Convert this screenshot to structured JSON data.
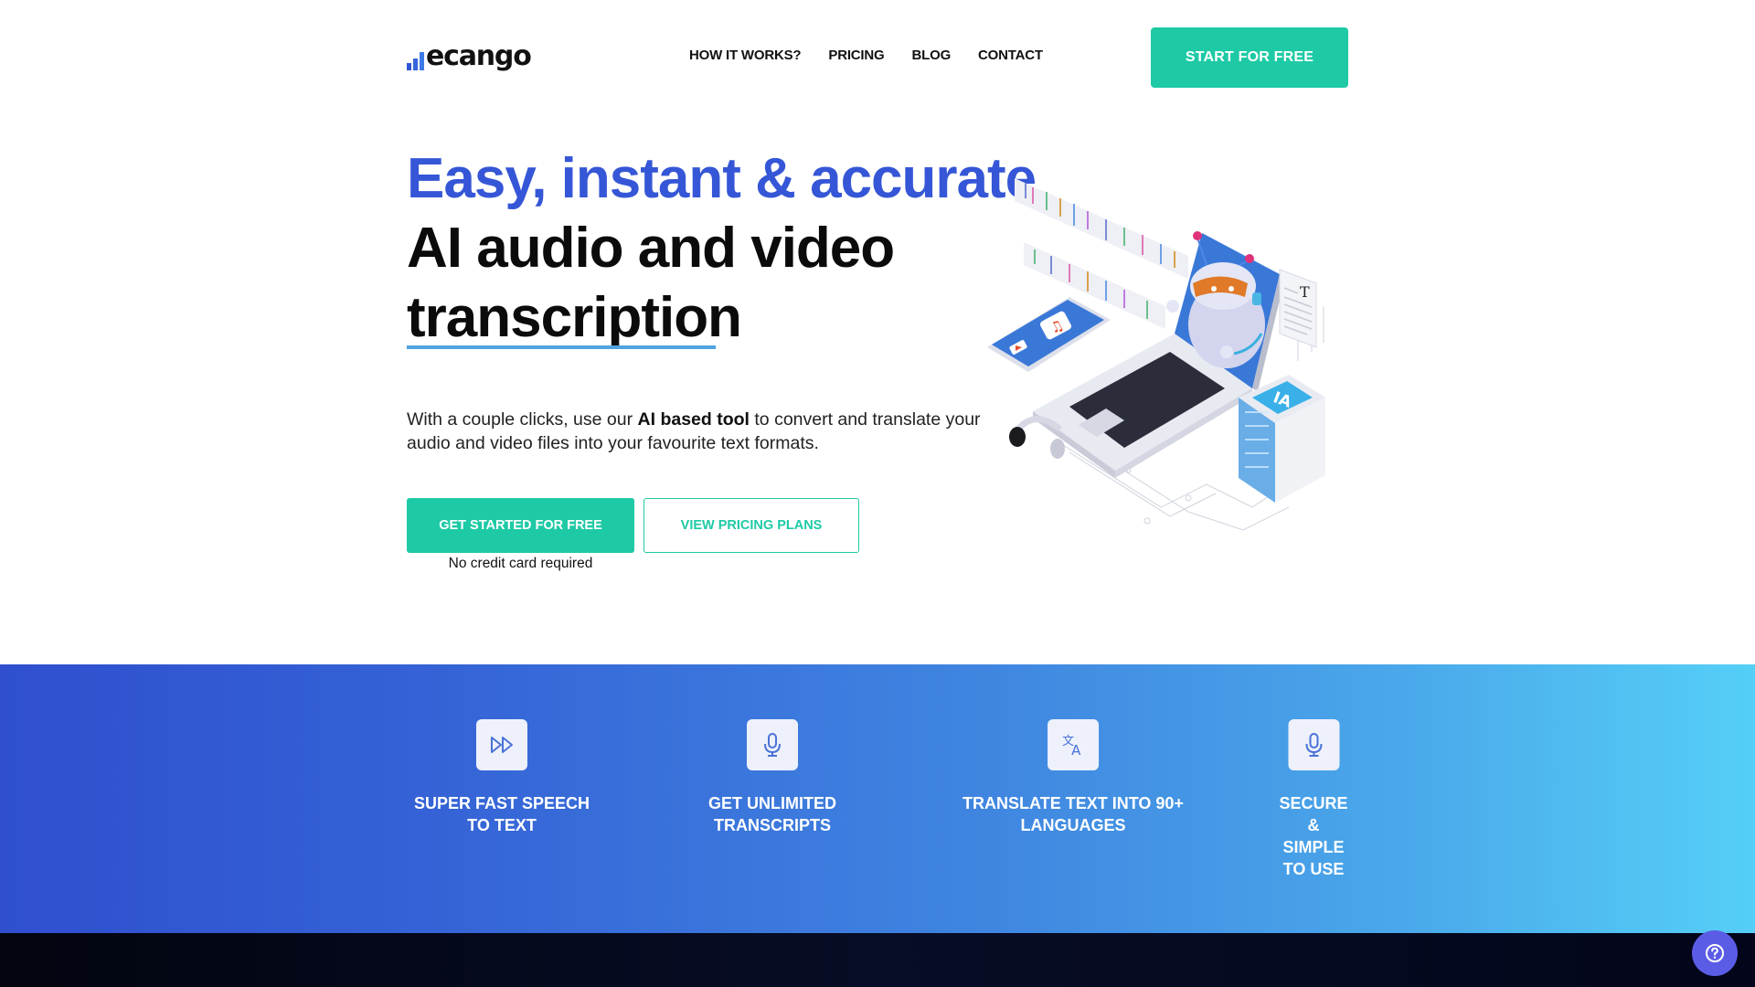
{
  "header": {
    "logo_text": "ecango",
    "nav": [
      {
        "label": "HOW IT WORKS?"
      },
      {
        "label": "PRICING"
      },
      {
        "label": "BLOG"
      },
      {
        "label": "CONTACT"
      }
    ],
    "cta_label": "START FOR FREE"
  },
  "hero": {
    "title_line1": "Easy, instant & accurate",
    "title_line2": "AI audio and video",
    "title_line3": "transcription",
    "desc_before": "With a couple clicks, use our ",
    "desc_bold": "AI based tool",
    "desc_after": " to convert and translate your audio and video files into your favourite text formats.",
    "primary_button": "GET STARTED FOR FREE",
    "secondary_button": "VIEW PRICING PLANS",
    "no_credit_card": "No credit card required",
    "illustration": {
      "semantic": "isometric laptop with AI robot, audio waveforms, music/video tablet, headphones, text document and IA chip",
      "chip_label": "IA",
      "doc_glyph": "T"
    }
  },
  "features": [
    {
      "icon": "fast-forward-icon",
      "label": "SUPER FAST SPEECH\nTO TEXT"
    },
    {
      "icon": "microphone-icon",
      "label": "GET UNLIMITED\nTRANSCRIPTS"
    },
    {
      "icon": "translate-icon",
      "label": "TRANSLATE TEXT INTO 90+\nLANGUAGES"
    },
    {
      "icon": "microphone-icon",
      "label": "SECURE\n&\nSIMPLE\nTO USE"
    }
  ],
  "help": {
    "icon": "question-circle-icon"
  },
  "colors": {
    "brand_blue": "#3556d6",
    "accent_green": "#1ecaa5",
    "underline_blue": "#4fa3e0",
    "help_purple": "#5b5ce6"
  }
}
